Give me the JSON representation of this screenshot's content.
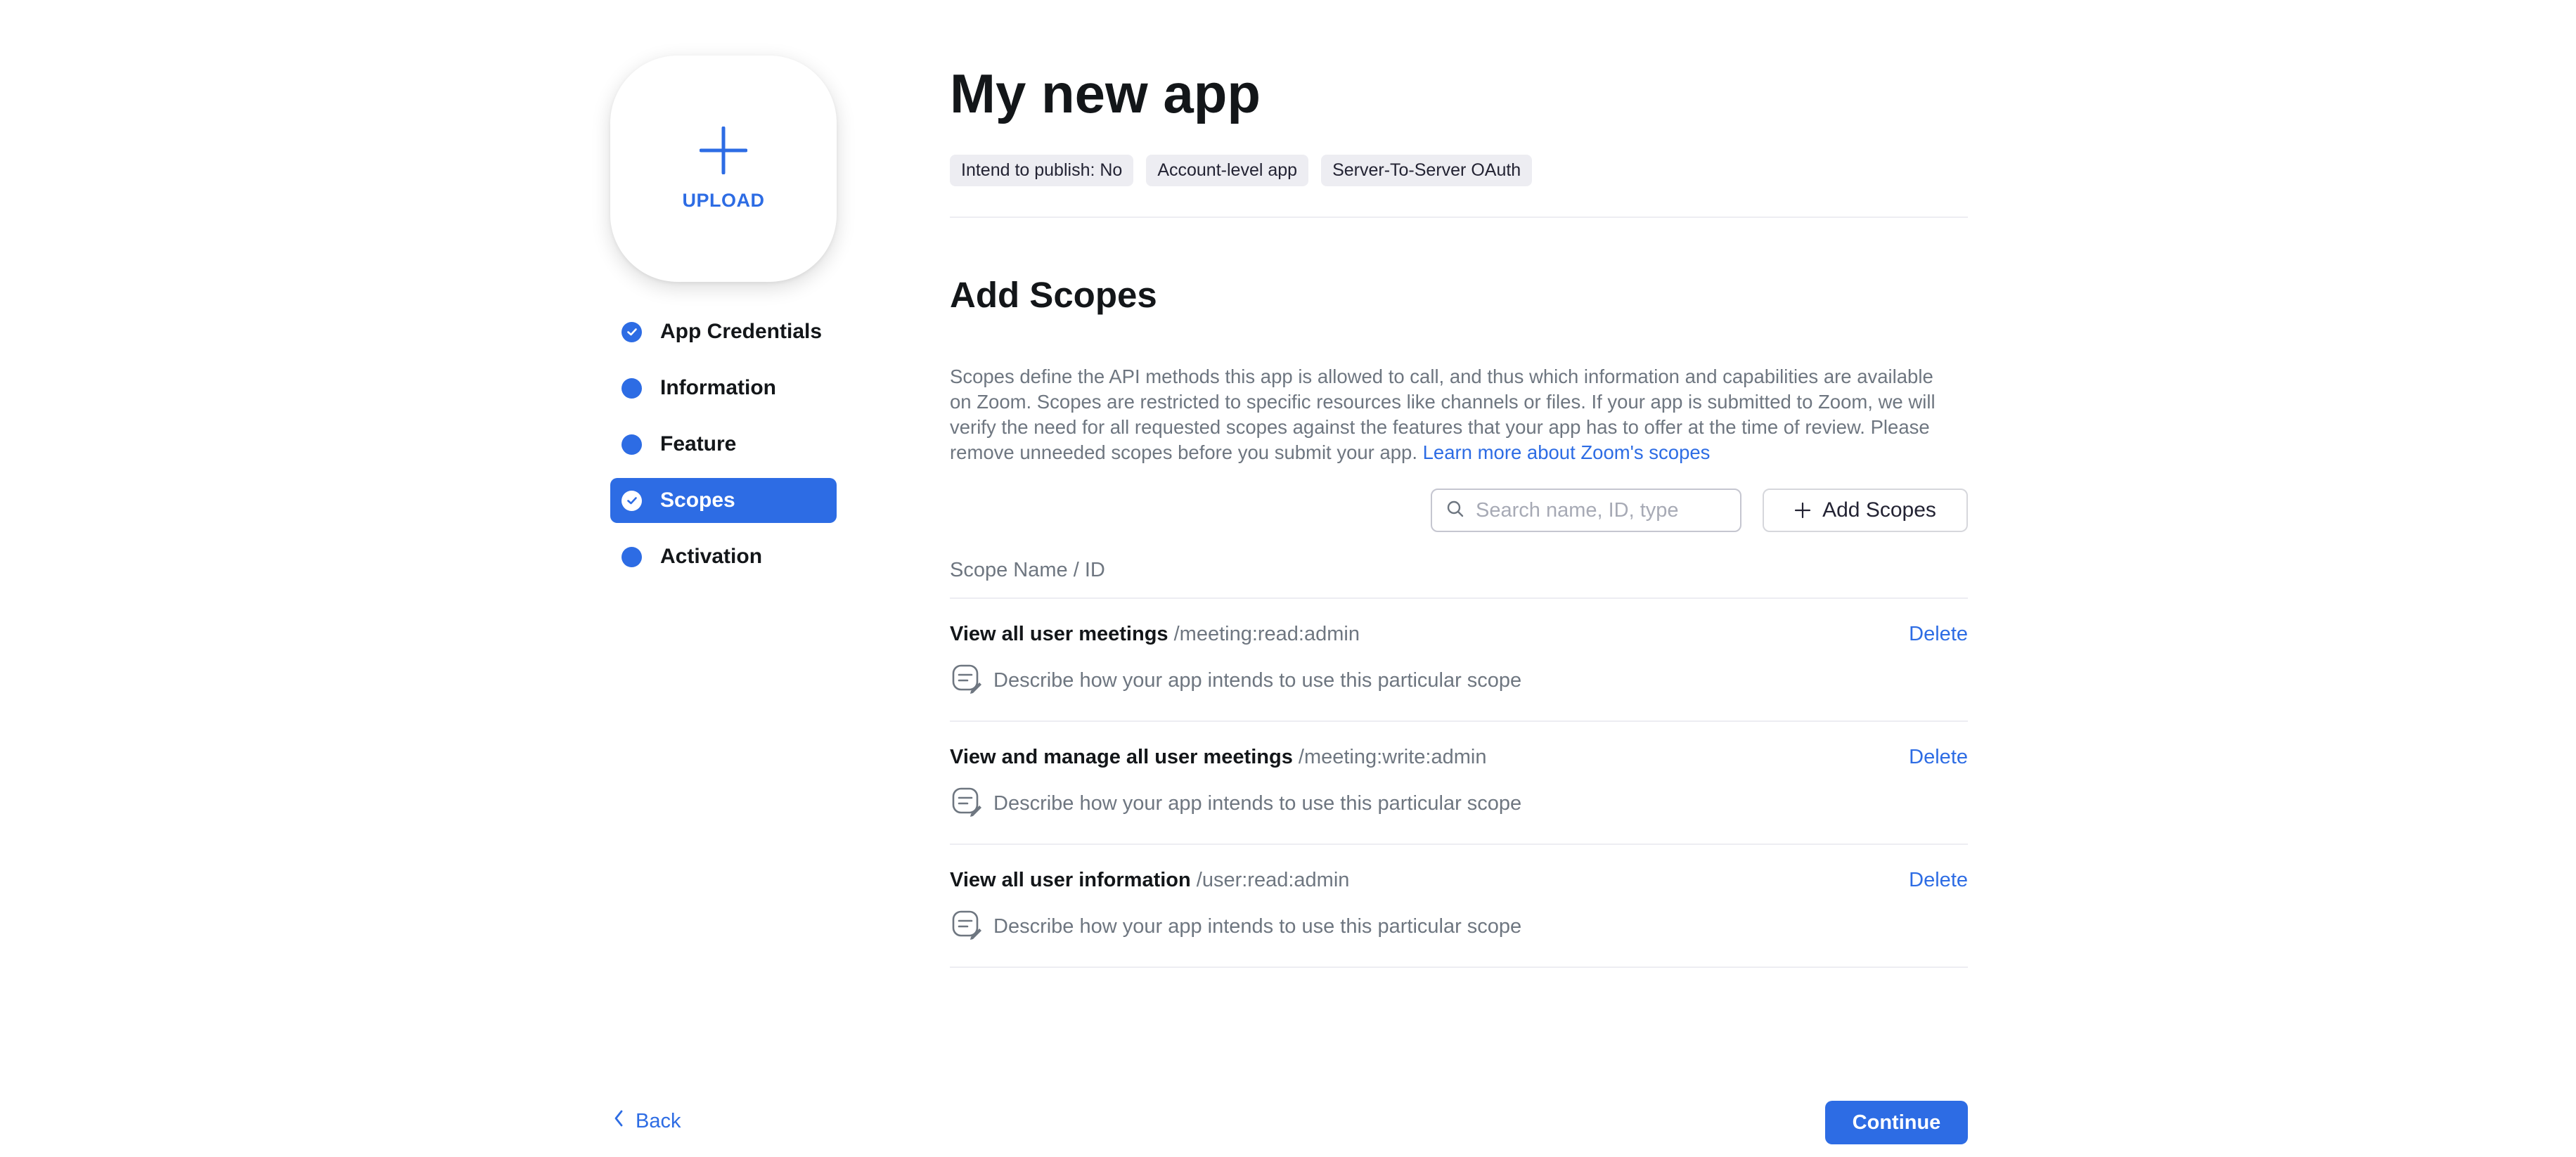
{
  "colors": {
    "accent": "#2d6ce4",
    "text_primary": "#131619",
    "text_muted": "#6e7680",
    "tag_bg": "#ededf2"
  },
  "upload": {
    "label": "UPLOAD",
    "icon": "plus-icon"
  },
  "sidebar": {
    "items": [
      {
        "label": "App Credentials",
        "icon": "check-circle-icon",
        "active": false
      },
      {
        "label": "Information",
        "icon": "dot-icon",
        "active": false
      },
      {
        "label": "Feature",
        "icon": "dot-icon",
        "active": false
      },
      {
        "label": "Scopes",
        "icon": "check-circle-icon",
        "active": true
      },
      {
        "label": "Activation",
        "icon": "dot-icon",
        "active": false
      }
    ]
  },
  "header": {
    "title": "My new app",
    "tags": [
      "Intend to publish: No",
      "Account-level app",
      "Server-To-Server OAuth"
    ]
  },
  "section": {
    "title": "Add Scopes",
    "description": "Scopes define the API methods this app is allowed to call, and thus which information and capabilities are available on Zoom. Scopes are restricted to specific resources like channels or files. If your app is submitted to Zoom, we will verify the need for all requested scopes against the features that your app has to offer at the time of review. Please remove unneeded scopes before you submit your app.",
    "learn_more": "Learn more about Zoom's scopes"
  },
  "search": {
    "placeholder": "Search name, ID, type",
    "value": "",
    "icon": "search-icon"
  },
  "add_scopes_button": {
    "label": "Add Scopes",
    "icon": "plus-icon"
  },
  "table": {
    "column_header": "Scope Name / ID",
    "rows": [
      {
        "name": "View all user meetings",
        "id": "/meeting:read:admin",
        "action": "Delete",
        "description_placeholder": "Describe how your app intends to use this particular scope"
      },
      {
        "name": "View and manage all user meetings",
        "id": "/meeting:write:admin",
        "action": "Delete",
        "description_placeholder": "Describe how your app intends to use this particular scope"
      },
      {
        "name": "View all user information",
        "id": "/user:read:admin",
        "action": "Delete",
        "description_placeholder": "Describe how your app intends to use this particular scope"
      }
    ]
  },
  "footer": {
    "back_label": "Back",
    "continue_label": "Continue"
  }
}
